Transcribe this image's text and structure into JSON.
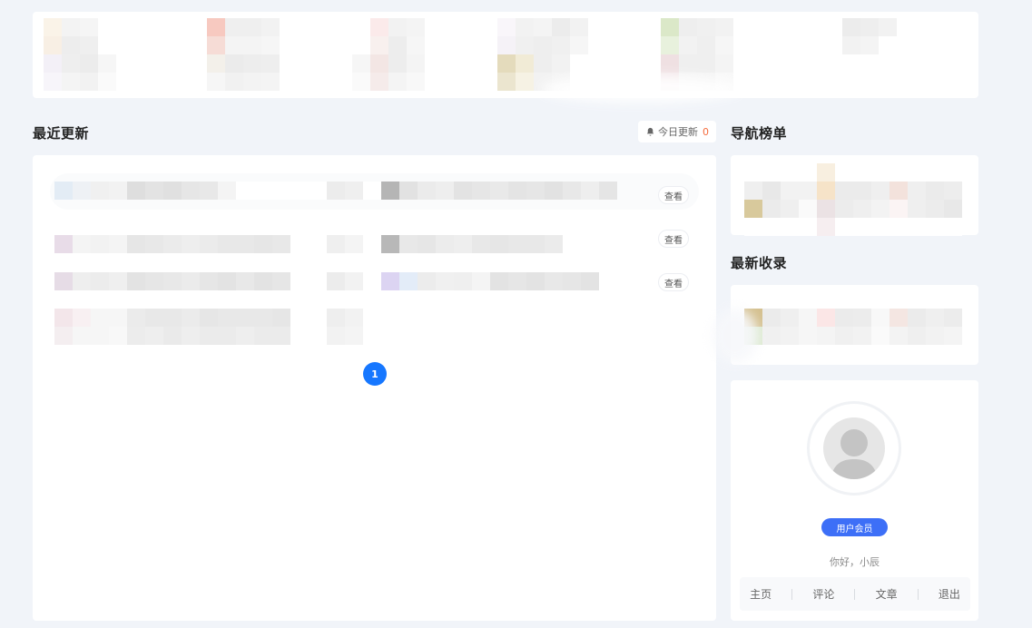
{
  "colors": {
    "page_bg": "#f1f4f9",
    "card_bg": "#ffffff",
    "accent_blue": "#1677ff",
    "member_blue": "#3d6ff7",
    "update_count": "#f56c3d"
  },
  "recent_updates": {
    "title": "最近更新",
    "today_label": "今日更新",
    "today_count": "0",
    "view_label": "查看",
    "pagination": {
      "current_page": "1"
    }
  },
  "nav_ranking": {
    "title": "导航榜单"
  },
  "latest_included": {
    "title": "最新收录"
  },
  "user_card": {
    "member_label": "用户会员",
    "greeting": "你好，小辰",
    "nav": [
      {
        "label": "主页"
      },
      {
        "label": "评论"
      },
      {
        "label": "文章"
      },
      {
        "label": "退出"
      }
    ]
  },
  "icons": {
    "bell": "bell-icon",
    "avatar": "default-avatar-icon"
  }
}
